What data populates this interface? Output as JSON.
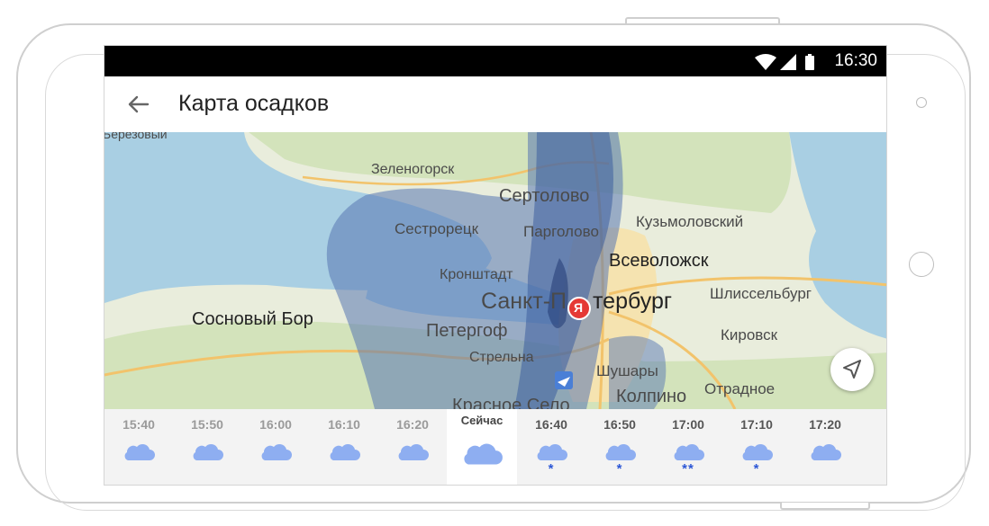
{
  "status_bar": {
    "time": "16:30"
  },
  "app_bar": {
    "title": "Карта осадков"
  },
  "map": {
    "labels": {
      "berezovy": "Березовый",
      "zelenogorsk": "Зеленогорск",
      "sertolovo": "Сертолово",
      "kuzmolovsky": "Кузьмоловский",
      "sestroretsk": "Сестрорецк",
      "pargolovo": "Парголово",
      "vsevolozhsk": "Всеволожск",
      "kronshtadt": "Кронштадт",
      "spb_left": "Санкт-П",
      "spb_right": "тербург",
      "shlisselburg": "Шлиссельбург",
      "sosnovy_bor": "Сосновый Бор",
      "petergof": "Петергоф",
      "kirovsk": "Кировск",
      "strelna": "Стрельна",
      "shushary": "Шушары",
      "otradnoe": "Отрадное",
      "kolpino": "Колпино",
      "krasnoe_selo": "Красное Село"
    },
    "marker_letter": "Я"
  },
  "timeline": [
    {
      "time": "15:40",
      "kind": "past",
      "snow": ""
    },
    {
      "time": "15:50",
      "kind": "past",
      "snow": ""
    },
    {
      "time": "16:00",
      "kind": "past",
      "snow": ""
    },
    {
      "time": "16:10",
      "kind": "past",
      "snow": ""
    },
    {
      "time": "16:20",
      "kind": "past",
      "snow": ""
    },
    {
      "time": "Сейчас",
      "kind": "now",
      "snow": ""
    },
    {
      "time": "16:40",
      "kind": "future",
      "snow": "*"
    },
    {
      "time": "16:50",
      "kind": "future",
      "snow": "*"
    },
    {
      "time": "17:00",
      "kind": "future",
      "snow": "**"
    },
    {
      "time": "17:10",
      "kind": "future",
      "snow": "*"
    },
    {
      "time": "17:20",
      "kind": "future",
      "snow": ""
    }
  ],
  "colors": {
    "water": "#a9cfe3",
    "land": "#e9eddc",
    "precip": "#5877b3",
    "accent": "#2c57d6",
    "cloud": "#8eaef1"
  }
}
